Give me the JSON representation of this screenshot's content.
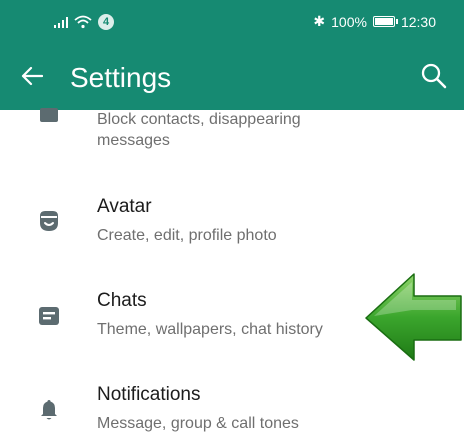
{
  "status_bar": {
    "notification_count": "4",
    "battery": "100%",
    "time": "12:30",
    "icons": [
      "signal-icon",
      "wifi-icon",
      "bluetooth-icon",
      "battery-icon"
    ]
  },
  "toolbar": {
    "title": "Settings",
    "back_icon": "arrow-left-icon",
    "search_icon": "search-icon"
  },
  "items": [
    {
      "title": "",
      "subtitle": "Block contacts, disappearing messages",
      "icon": "lock-icon"
    },
    {
      "title": "Avatar",
      "subtitle": "Create, edit, profile photo",
      "icon": "avatar-icon"
    },
    {
      "title": "Chats",
      "subtitle": "Theme, wallpapers, chat history",
      "icon": "chat-icon"
    },
    {
      "title": "Notifications",
      "subtitle": "Message, group & call tones",
      "icon": "bell-icon"
    }
  ],
  "overlay": {
    "icon": "green-arrow-left-icon"
  },
  "colors": {
    "accent": "#168a72",
    "icon": "#5c6b70",
    "arrow": "#2e9a22"
  }
}
